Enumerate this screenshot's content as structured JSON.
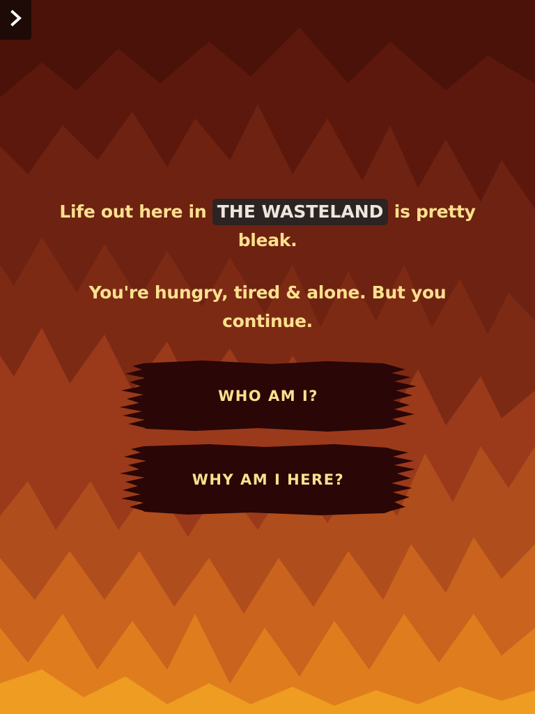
{
  "menu_button": {
    "icon": "chevron-right-icon"
  },
  "story": {
    "line1_before": "Life out here in ",
    "location_tag": "THE WASTELAND",
    "line1_after": " is pretty bleak.",
    "paragraph2": "You're hungry, tired & alone. But you continue."
  },
  "choices": [
    {
      "label": "WHO AM I?"
    },
    {
      "label": "WHY AM I HERE?"
    }
  ],
  "colors": {
    "text": "#fbe08e",
    "button_fill": "#2a0606",
    "tag_bg": "#2b2422",
    "tag_text": "#ece6de"
  }
}
